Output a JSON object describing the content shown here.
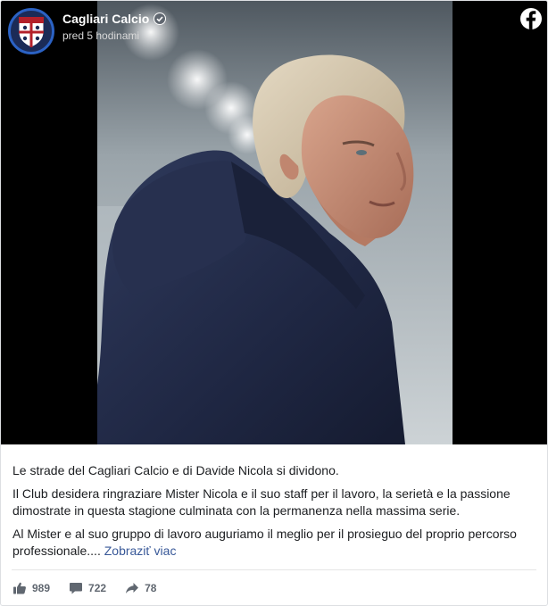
{
  "post": {
    "page_name": "Cagliari Calcio",
    "timestamp": "pred 5 hodinami",
    "paragraphs": [
      "Le strade del Cagliari Calcio e di Davide Nicola si dividono.",
      "Il Club desidera ringraziare Mister Nicola e il suo staff per il lavoro, la serietà e la passione dimostrate in questa stagione culminata con la permanenza nella massima serie.",
      "Al Mister e al suo gruppo di lavoro auguriamo il meglio per il prosieguo del proprio percorso professionale...."
    ],
    "see_more_label": "Zobraziť viac"
  },
  "stats": {
    "likes": "989",
    "comments": "722",
    "shares": "78"
  },
  "colors": {
    "link": "#385898",
    "avatar_bg": "#1b2b57",
    "avatar_ring": "#2b62c4"
  }
}
